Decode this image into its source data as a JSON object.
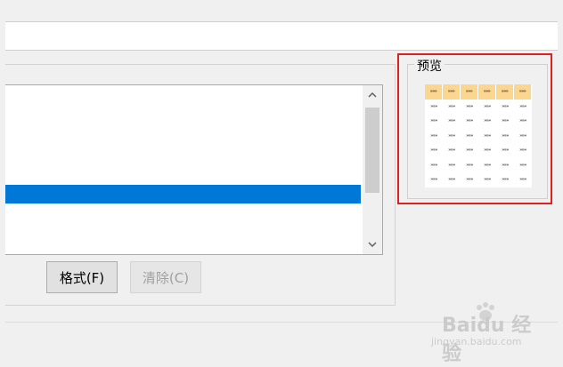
{
  "buttons": {
    "format_label": "格式(F)",
    "clear_label": "清除(C)"
  },
  "preview": {
    "title": "预览",
    "rows": [
      [
        "»»»",
        "»»»",
        "»»»",
        "»»»",
        "»»»",
        "»»»"
      ],
      [
        "»»»",
        "»»»",
        "»»»",
        "»»»",
        "»»»",
        "»»»"
      ],
      [
        "»»»",
        "»»»",
        "»»»",
        "»»»",
        "»»»",
        "»»»"
      ],
      [
        "»»»",
        "»»»",
        "»»»",
        "»»»",
        "»»»",
        "»»»"
      ],
      [
        "»»»",
        "»»»",
        "»»»",
        "»»»",
        "»»»",
        "»»»"
      ],
      [
        "»»»",
        "»»»",
        "»»»",
        "»»»",
        "»»»",
        "»»»"
      ],
      [
        "»»»",
        "»»»",
        "»»»",
        "»»»",
        "»»»",
        "»»»"
      ]
    ]
  },
  "colors": {
    "selection": "#0078d7",
    "header_fill": "#fcd58f",
    "highlight": "#e02020"
  },
  "watermark": {
    "brand": "Baidu 经验",
    "url": "jingyan.baidu.com"
  },
  "icons": [
    "scroll-up-icon",
    "scroll-down-icon",
    "baidu-paw-icon"
  ]
}
